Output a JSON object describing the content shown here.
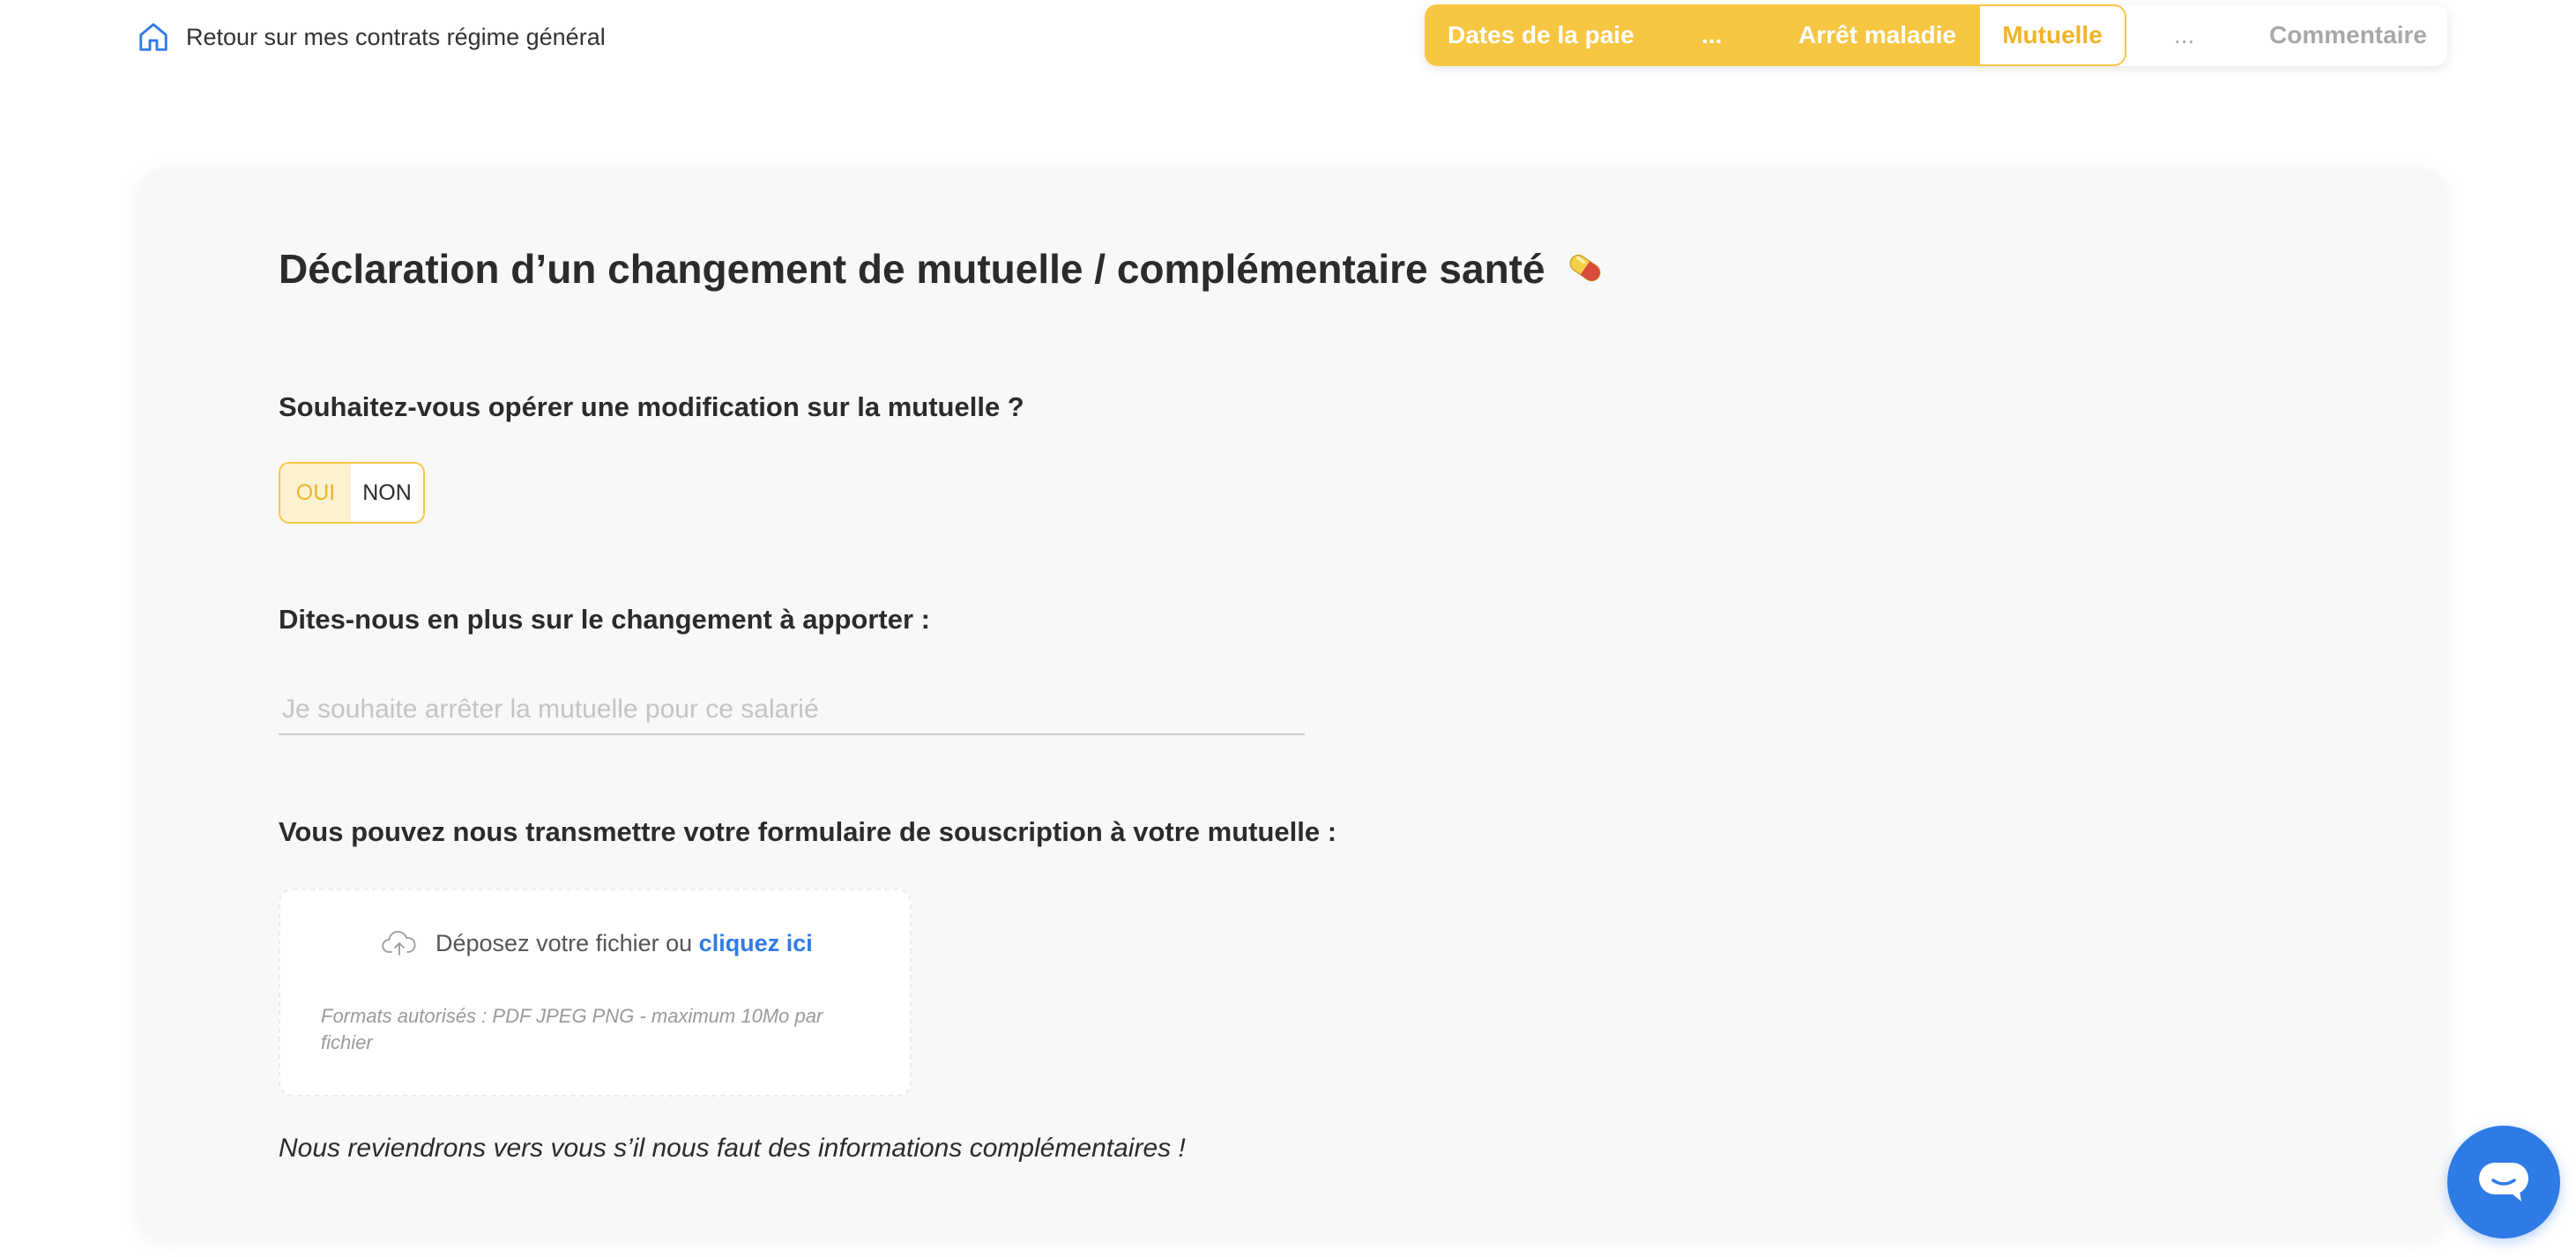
{
  "back_link": {
    "label": "Retour sur mes contrats régime général",
    "icon": "home-icon"
  },
  "stepper": {
    "steps": [
      {
        "label": "Dates de la paie",
        "state": "done"
      },
      {
        "label": "...",
        "state": "done"
      },
      {
        "label": "Arrêt maladie",
        "state": "done"
      },
      {
        "label": "Mutuelle",
        "state": "current"
      },
      {
        "label": "...",
        "state": "todo"
      },
      {
        "label": "Commentaire",
        "state": "todo"
      }
    ],
    "accent_color": "#f7c744"
  },
  "form": {
    "title": "Déclaration d’un changement de mutuelle / complémentaire santé",
    "title_icon": "pill-icon",
    "question_modify": "Souhaitez-vous opérer une modification sur la mutuelle ?",
    "toggle": {
      "yes_label": "OUI",
      "no_label": "NON",
      "selected": "OUI"
    },
    "question_details": "Dites-nous en plus sur le changement à apporter :",
    "details_input": {
      "value": "",
      "placeholder": "Je souhaite arrêter la mutuelle pour ce salarié"
    },
    "question_upload": "Vous pouvez nous transmettre votre formulaire de souscription à votre mutuelle :",
    "upload": {
      "icon": "cloud-upload-icon",
      "text": "Déposez votre fichier ou",
      "link": "cliquez ici",
      "formats": "Formats autorisés : PDF JPEG PNG - maximum 10Mo par fichier"
    },
    "note": "Nous reviendrons vers vous s’il nous faut des informations complémentaires !"
  },
  "chat": {
    "icon": "chat-icon",
    "color": "#2f7be5"
  }
}
